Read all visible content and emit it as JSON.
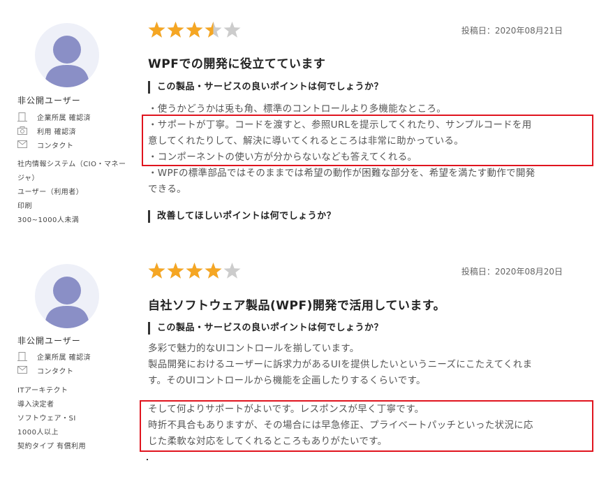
{
  "reviews": [
    {
      "user_name": "非公開ユーザー",
      "badges": [
        {
          "icon": "building-icon",
          "label": "企業所属 確認済"
        },
        {
          "icon": "camera-icon",
          "label": "利用 確認済"
        },
        {
          "icon": "envelope-icon",
          "label": "コンタクト"
        }
      ],
      "meta": [
        "社内情報システム（CIO・マネー",
        "ジャ）",
        "ユーザー（利用者）",
        "印刷",
        "300~1000人未満"
      ],
      "rating": 3.5,
      "date": "投稿日：2020年08月21日",
      "title": "WPFでの開発に役立てています",
      "q1": "この製品・サービスの良いポイントは何でしょうか？",
      "lines": [
        "・使うかどうかは兎も角、標準のコントロールより多機能なところ。",
        "・サポートが丁寧。コードを渡すと、参照URLを提示してくれたり、サンプルコードを用",
        "意してくれたりして、解決に導いてくれるところは非常に助かっている。",
        "・コンポーネントの使い方が分からないなども答えてくれる。",
        "・WPFの標準部品ではそのままでは希望の動作が困難な部分を、希望を満たす動作で開発",
        "できる。"
      ],
      "q2": "改善してほしいポイントは何でしょうか？"
    },
    {
      "user_name": "非公開ユーザー",
      "badges": [
        {
          "icon": "building-icon",
          "label": "企業所属 確認済"
        },
        {
          "icon": "envelope-icon",
          "label": "コンタクト"
        }
      ],
      "meta": [
        "ITアーキテクト",
        "導入決定者",
        "ソフトウェア・SI",
        "1000人以上",
        "契約タイプ 有償利用"
      ],
      "rating": 4,
      "date": "投稿日：2020年08月20日",
      "title": "自社ソフトウェア製品(WPF)開発で活用しています。",
      "q1": "この製品・サービスの良いポイントは何でしょうか？",
      "lines": [
        "多彩で魅力的なUIコントロールを揃しています。",
        "製品開発におけるユーザーに訴求力があるUIを提供したいというニーズにこたえてくれま",
        "す。そのUIコントロールから機能を企画したりするくらいです。",
        "そして何よりサポートがよいです。レスポンスが早く丁寧です。",
        "時折不具合もありますが、その場合には早急修正、プライベートパッチといった状況に応",
        "じた柔軟な対応をしてくれるところもありがたいです。"
      ]
    }
  ],
  "colors": {
    "star_on": "#f5a623",
    "star_off": "#cccccc",
    "highlight": "#e0141e",
    "avatar": "#8a8fc6"
  }
}
